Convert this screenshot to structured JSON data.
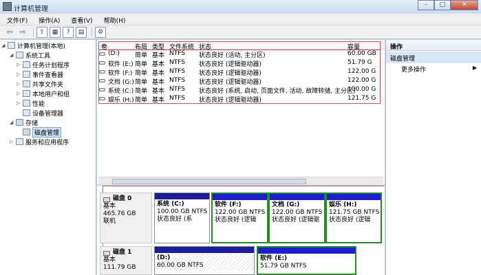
{
  "window": {
    "title": "计算机管理",
    "buttons": [
      "–",
      "□",
      "✕"
    ]
  },
  "menu": [
    "文件(F)",
    "操作(A)",
    "查看(V)",
    "帮助(H)"
  ],
  "toolbar": {
    "icons": [
      "back-icon",
      "forward-icon",
      "up-icon",
      "show-tree-icon",
      "help-icon",
      "properties-icon",
      "export-icon"
    ]
  },
  "tree": {
    "root": "计算机管理(本地)",
    "system_tools": "系统工具",
    "items": [
      "任务计划程序",
      "事件查看器",
      "共享文件夹",
      "本地用户和组",
      "性能",
      "设备管理器"
    ],
    "storage": "存储",
    "disk_mgmt": "磁盘管理",
    "services": "服务和应用程序"
  },
  "volumes": {
    "headers": [
      "卷",
      "布局",
      "类型",
      "文件系统",
      "状态",
      "容量"
    ],
    "rows": [
      [
        "(D:)",
        "简单",
        "基本",
        "NTFS",
        "状态良好 (活动, 主分区)",
        "60.00 GB"
      ],
      [
        "软件 (E:)",
        "简单",
        "基本",
        "NTFS",
        "状态良好 (逻辑驱动器)",
        "51.79 G"
      ],
      [
        "软件 (F:)",
        "简单",
        "基本",
        "NTFS",
        "状态良好 (逻辑驱动器)",
        "122.00 G"
      ],
      [
        "文档 (G:)",
        "简单",
        "基本",
        "NTFS",
        "状态良好 (逻辑驱动器)",
        "122.00 G"
      ],
      [
        "系统 (C:)",
        "简单",
        "基本",
        "NTFS",
        "状态良好 (系统, 启动, 页面文件, 活动, 故障转储, 主分区)",
        "100.00 G"
      ],
      [
        "娱乐 (H:)",
        "简单",
        "基本",
        "NTFS",
        "状态良好 (逻辑驱动器)",
        "121.75 G"
      ]
    ]
  },
  "actions": {
    "title": "操作",
    "section": "磁盘管理",
    "more": "更多操作",
    "arrow": "▶"
  },
  "disks": [
    {
      "name": "磁盘 0",
      "type": "基本",
      "size": "465.76 GB",
      "status": "联机",
      "partitions": [
        {
          "name": "系统 (C:)",
          "size": "100.00 GB NTFS",
          "status": "状态良好 (系"
        },
        {
          "name": "软件 (F:)",
          "size": "122.00 GB NTFS",
          "status": "状态良好 (逻辑"
        },
        {
          "name": "文档 (G:)",
          "size": "122.00 GB NTFS",
          "status": "状态良好 (逻辑驱"
        },
        {
          "name": "娱乐 (H:)",
          "size": "121.75 GB NTFS",
          "status": "状态良好 (逻辑"
        }
      ]
    },
    {
      "name": "磁盘 1",
      "type": "基本",
      "size": "111.79 GB",
      "status": "",
      "partitions": [
        {
          "name": "(D:)",
          "size": "60.00 GB NTFS",
          "status": ""
        },
        {
          "name": "软件 (E:)",
          "size": "51.79 GB NTFS",
          "status": ""
        }
      ]
    }
  ],
  "colors": {
    "primary_partition": "#1b1b9e",
    "logical_drive": "#1d1dd6",
    "selected_border": "#1f8f1f",
    "annotation": "#d9534f"
  }
}
